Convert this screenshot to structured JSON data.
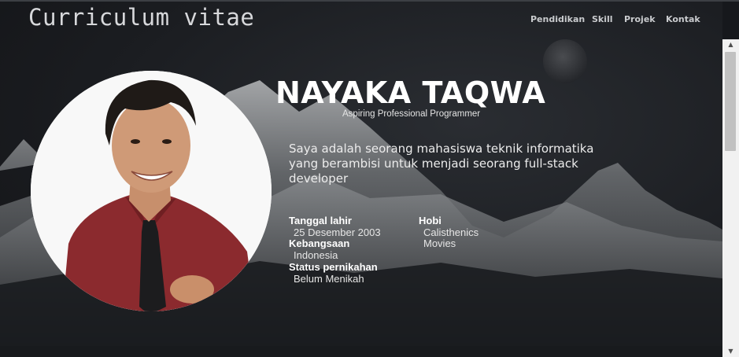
{
  "header": {
    "brand": "Curriculum vitae",
    "nav": [
      "Pendidikan",
      "Skill",
      "Projek",
      "Kontak"
    ]
  },
  "profile": {
    "name": "NAYAKA TAQWA",
    "tagline": "Aspiring Professional Programmer",
    "bio": "Saya adalah seorang mahasiswa teknik informatika yang berambisi untuk menjadi seorang full-stack developer"
  },
  "details_left": [
    {
      "label": "Tanggal lahir",
      "value": "25 Desember 2003"
    },
    {
      "label": "Kebangsaan",
      "value": "Indonesia"
    },
    {
      "label": "Status pernikahan",
      "value": "Belum Menikah"
    }
  ],
  "details_right": {
    "label": "Hobi",
    "values": [
      "Calisthenics",
      "Movies"
    ]
  },
  "colors": {
    "background": "#16181c",
    "heading": "#ffffff",
    "nav_text": "#c9cbce",
    "shirt": "#8b2a2e"
  },
  "icons": {
    "scroll_up": "▲",
    "scroll_down": "▼"
  }
}
